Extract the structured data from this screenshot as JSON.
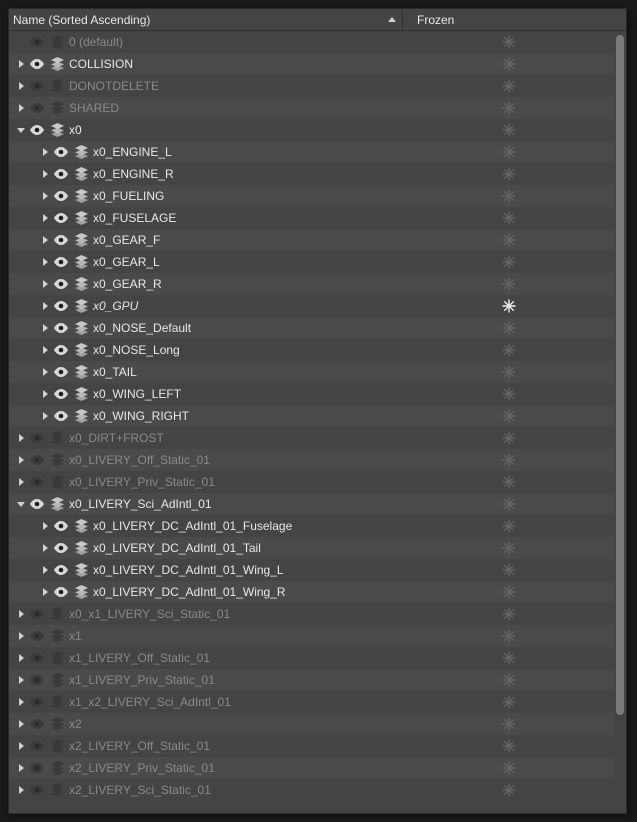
{
  "header": {
    "name_label": "Name (Sorted Ascending)",
    "frozen_label": "Frozen"
  },
  "rows": [
    {
      "indent": 0,
      "arrow": "none",
      "eye": false,
      "label": "0 (default)",
      "dim": true,
      "italic": false,
      "frozen_active": false
    },
    {
      "indent": 0,
      "arrow": "right",
      "eye": true,
      "label": "COLLISION",
      "dim": false,
      "italic": false,
      "frozen_active": false
    },
    {
      "indent": 0,
      "arrow": "right",
      "eye": false,
      "label": "DONOTDELETE",
      "dim": true,
      "italic": false,
      "frozen_active": false
    },
    {
      "indent": 0,
      "arrow": "right",
      "eye": false,
      "label": "SHARED",
      "dim": true,
      "italic": false,
      "frozen_active": false
    },
    {
      "indent": 0,
      "arrow": "down",
      "eye": true,
      "label": "x0",
      "dim": false,
      "italic": false,
      "frozen_active": false
    },
    {
      "indent": 1,
      "arrow": "right",
      "eye": true,
      "label": "x0_ENGINE_L",
      "dim": false,
      "italic": false,
      "frozen_active": false
    },
    {
      "indent": 1,
      "arrow": "right",
      "eye": true,
      "label": "x0_ENGINE_R",
      "dim": false,
      "italic": false,
      "frozen_active": false
    },
    {
      "indent": 1,
      "arrow": "right",
      "eye": true,
      "label": "x0_FUELING",
      "dim": false,
      "italic": false,
      "frozen_active": false
    },
    {
      "indent": 1,
      "arrow": "right",
      "eye": true,
      "label": "x0_FUSELAGE",
      "dim": false,
      "italic": false,
      "frozen_active": false
    },
    {
      "indent": 1,
      "arrow": "right",
      "eye": true,
      "label": "x0_GEAR_F",
      "dim": false,
      "italic": false,
      "frozen_active": false
    },
    {
      "indent": 1,
      "arrow": "right",
      "eye": true,
      "label": "x0_GEAR_L",
      "dim": false,
      "italic": false,
      "frozen_active": false
    },
    {
      "indent": 1,
      "arrow": "right",
      "eye": true,
      "label": "x0_GEAR_R",
      "dim": false,
      "italic": false,
      "frozen_active": false
    },
    {
      "indent": 1,
      "arrow": "right",
      "eye": true,
      "label": "x0_GPU",
      "dim": false,
      "italic": true,
      "frozen_active": true
    },
    {
      "indent": 1,
      "arrow": "right",
      "eye": true,
      "label": "x0_NOSE_Default",
      "dim": false,
      "italic": false,
      "frozen_active": false
    },
    {
      "indent": 1,
      "arrow": "right",
      "eye": true,
      "label": "x0_NOSE_Long",
      "dim": false,
      "italic": false,
      "frozen_active": false
    },
    {
      "indent": 1,
      "arrow": "right",
      "eye": true,
      "label": "x0_TAIL",
      "dim": false,
      "italic": false,
      "frozen_active": false
    },
    {
      "indent": 1,
      "arrow": "right",
      "eye": true,
      "label": "x0_WING_LEFT",
      "dim": false,
      "italic": false,
      "frozen_active": false
    },
    {
      "indent": 1,
      "arrow": "right",
      "eye": true,
      "label": "x0_WING_RIGHT",
      "dim": false,
      "italic": false,
      "frozen_active": false
    },
    {
      "indent": 0,
      "arrow": "right",
      "eye": false,
      "label": "x0_DIRT+FROST",
      "dim": true,
      "italic": false,
      "frozen_active": false
    },
    {
      "indent": 0,
      "arrow": "right",
      "eye": false,
      "label": "x0_LIVERY_Off_Static_01",
      "dim": true,
      "italic": false,
      "frozen_active": false
    },
    {
      "indent": 0,
      "arrow": "right",
      "eye": false,
      "label": "x0_LIVERY_Priv_Static_01",
      "dim": true,
      "italic": false,
      "frozen_active": false
    },
    {
      "indent": 0,
      "arrow": "down",
      "eye": true,
      "label": "x0_LIVERY_Sci_AdIntl_01",
      "dim": false,
      "italic": false,
      "frozen_active": false
    },
    {
      "indent": 1,
      "arrow": "right",
      "eye": true,
      "label": "x0_LIVERY_DC_AdIntl_01_Fuselage",
      "dim": false,
      "italic": false,
      "frozen_active": false
    },
    {
      "indent": 1,
      "arrow": "right",
      "eye": true,
      "label": "x0_LIVERY_DC_AdIntl_01_Tail",
      "dim": false,
      "italic": false,
      "frozen_active": false
    },
    {
      "indent": 1,
      "arrow": "right",
      "eye": true,
      "label": "x0_LIVERY_DC_AdIntl_01_Wing_L",
      "dim": false,
      "italic": false,
      "frozen_active": false
    },
    {
      "indent": 1,
      "arrow": "right",
      "eye": true,
      "label": "x0_LIVERY_DC_AdIntl_01_Wing_R",
      "dim": false,
      "italic": false,
      "frozen_active": false
    },
    {
      "indent": 0,
      "arrow": "right",
      "eye": false,
      "label": "x0_x1_LIVERY_Sci_Static_01",
      "dim": true,
      "italic": false,
      "frozen_active": false
    },
    {
      "indent": 0,
      "arrow": "right",
      "eye": false,
      "label": "x1",
      "dim": true,
      "italic": false,
      "frozen_active": false
    },
    {
      "indent": 0,
      "arrow": "right",
      "eye": false,
      "label": "x1_LIVERY_Off_Static_01",
      "dim": true,
      "italic": false,
      "frozen_active": false
    },
    {
      "indent": 0,
      "arrow": "right",
      "eye": false,
      "label": "x1_LIVERY_Priv_Static_01",
      "dim": true,
      "italic": false,
      "frozen_active": false
    },
    {
      "indent": 0,
      "arrow": "right",
      "eye": false,
      "label": "x1_x2_LIVERY_Sci_AdIntl_01",
      "dim": true,
      "italic": false,
      "frozen_active": false
    },
    {
      "indent": 0,
      "arrow": "right",
      "eye": false,
      "label": "x2",
      "dim": true,
      "italic": false,
      "frozen_active": false
    },
    {
      "indent": 0,
      "arrow": "right",
      "eye": false,
      "label": "x2_LIVERY_Off_Static_01",
      "dim": true,
      "italic": false,
      "frozen_active": false
    },
    {
      "indent": 0,
      "arrow": "right",
      "eye": false,
      "label": "x2_LIVERY_Priv_Static_01",
      "dim": true,
      "italic": false,
      "frozen_active": false
    },
    {
      "indent": 0,
      "arrow": "right",
      "eye": false,
      "label": "x2_LIVERY_Sci_Static_01",
      "dim": true,
      "italic": false,
      "frozen_active": false
    }
  ]
}
